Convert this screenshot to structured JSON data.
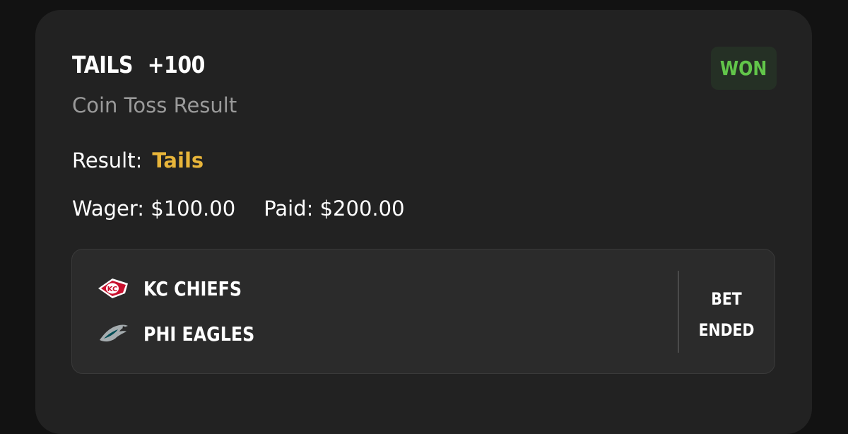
{
  "bet": {
    "selection": "TAILS",
    "odds": "+100",
    "market": "Coin Toss Result",
    "status": "WON",
    "result_label": "Result:",
    "result_value": "Tails",
    "wager_label": "Wager:",
    "wager_value": "$100.00",
    "paid_label": "Paid:",
    "paid_value": "$200.00"
  },
  "matchup": {
    "teams": [
      {
        "name": "KC CHIEFS",
        "logo": "kc-chiefs-logo"
      },
      {
        "name": "PHI EAGLES",
        "logo": "phi-eagles-logo"
      }
    ],
    "bet_status_line1": "BET",
    "bet_status_line2": "ENDED"
  },
  "colors": {
    "background": "#121212",
    "card": "#222222",
    "won_green": "#62c64a",
    "result_gold": "#e8b53a",
    "subtitle_gray": "#9a9a9a"
  }
}
